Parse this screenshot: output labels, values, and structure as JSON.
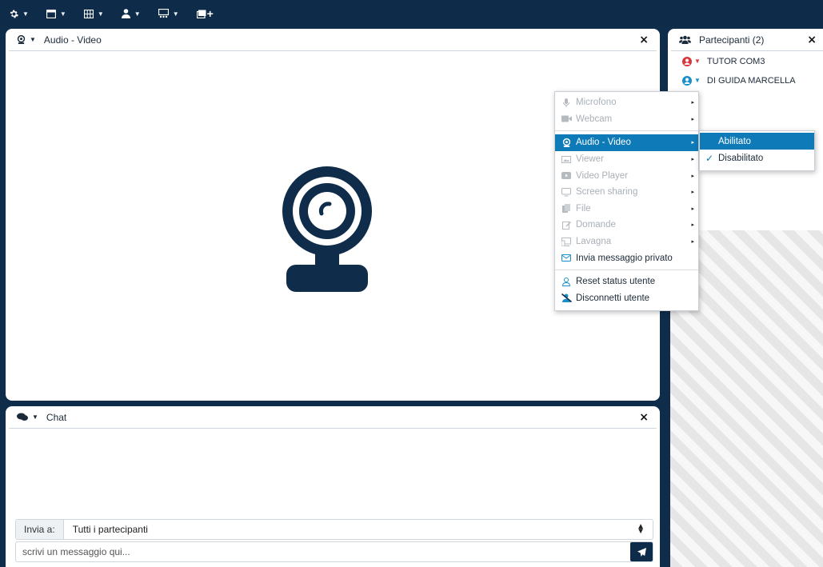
{
  "toolbar": {
    "buttons": [
      {
        "icon": "gear-icon",
        "has_caret": true
      },
      {
        "icon": "window-icon",
        "has_caret": true
      },
      {
        "icon": "grid-layout-icon",
        "has_caret": true
      },
      {
        "icon": "user-icon",
        "has_caret": true
      },
      {
        "icon": "presentation-icon",
        "has_caret": true
      },
      {
        "icon": "add-window-icon",
        "label": "+"
      }
    ]
  },
  "av_panel": {
    "title": "Audio - Video",
    "close": "×"
  },
  "chat_panel": {
    "title": "Chat",
    "close": "×",
    "send_to_label": "Invia a:",
    "send_to_value": "Tutti i partecipanti",
    "message_placeholder": "scrivi un messaggio qui..."
  },
  "participants_panel": {
    "title": "Partecipanti (2)",
    "close": "×",
    "participants": [
      {
        "name": "TUTOR COM3",
        "status_color": "#d9363e"
      },
      {
        "name": "DI GUIDA MARCELLA",
        "status_color": "#1a8fc9"
      }
    ]
  },
  "context_menu": {
    "items": [
      {
        "label": "Microfono",
        "icon": "microphone-icon",
        "disabled": true,
        "submenu": true
      },
      {
        "label": "Webcam",
        "icon": "camera-icon",
        "disabled": true,
        "submenu": true
      },
      {
        "label": "Audio - Video",
        "icon": "webcam-icon",
        "disabled": false,
        "submenu": true,
        "active": true
      },
      {
        "label": "Viewer",
        "icon": "image-icon",
        "disabled": true,
        "submenu": true
      },
      {
        "label": "Video Player",
        "icon": "video-icon",
        "disabled": true,
        "submenu": true
      },
      {
        "label": "Screen sharing",
        "icon": "monitor-icon",
        "disabled": true,
        "submenu": true
      },
      {
        "label": "File",
        "icon": "file-icon",
        "disabled": true,
        "submenu": true
      },
      {
        "label": "Domande",
        "icon": "edit-icon",
        "disabled": true,
        "submenu": true
      },
      {
        "label": "Lavagna",
        "icon": "whiteboard-icon",
        "disabled": true,
        "submenu": true
      },
      {
        "label": "Invia messaggio privato",
        "icon": "envelope-icon",
        "disabled": false,
        "submenu": false
      },
      {
        "label": "Reset status utente",
        "icon": "user-outline-icon",
        "disabled": false,
        "submenu": false
      },
      {
        "label": "Disconnetti utente",
        "icon": "user-slash-icon",
        "disabled": false,
        "submenu": false
      }
    ],
    "submenu": {
      "items": [
        {
          "label": "Abilitato",
          "active": true,
          "checked": false
        },
        {
          "label": "Disabilitato",
          "active": false,
          "checked": true
        }
      ]
    }
  },
  "colors": {
    "frame": "#0e2c49",
    "accent": "#0e7ab8",
    "disabled_text": "#a9b0b7"
  }
}
